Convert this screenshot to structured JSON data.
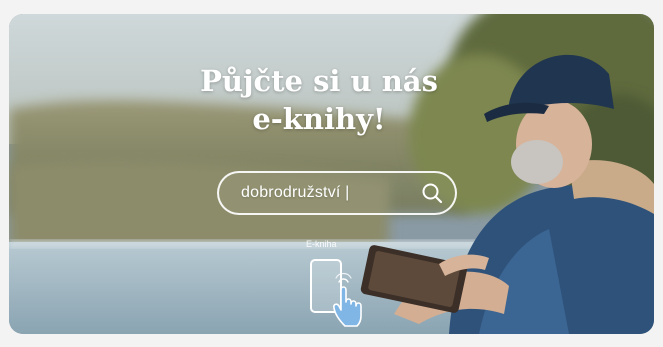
{
  "banner": {
    "title_line1": "Půjčte si u nás",
    "title_line2": "e-knihy!",
    "search_value": "dobrodružství |",
    "ebook_label": "E-kniha"
  },
  "icons": {
    "search": "search-icon",
    "ebook": "ebook-tap-icon"
  },
  "colors": {
    "text": "#ffffff",
    "sky": "#c9d3d6",
    "water": "#a9c0cc",
    "jacket": "#2c4d73"
  }
}
